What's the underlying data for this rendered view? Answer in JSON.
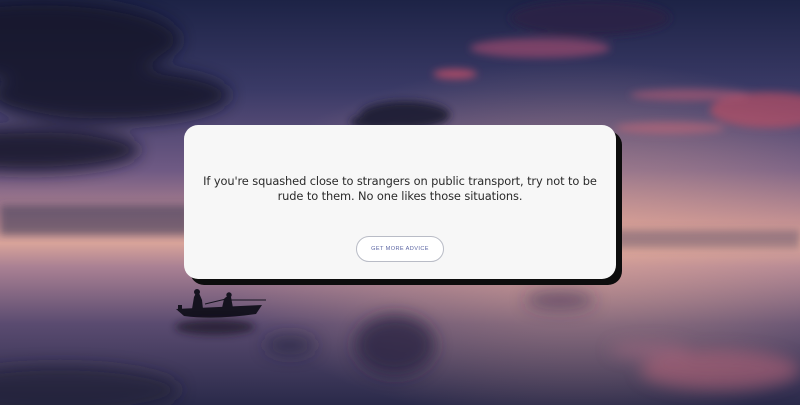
{
  "advice": {
    "text": "If you're squashed close to strangers on public transport, try not to be rude to them. No one likes those situations."
  },
  "button": {
    "label": "GET MORE ADVICE"
  },
  "colors": {
    "card_background": "#f7f7f7",
    "card_shadow": "#0d0d0d",
    "button_text": "#5c66a3",
    "button_border": "#b9bcc6",
    "text": "#2a2a2a"
  },
  "background": {
    "scene": "sunset-lake-with-fishing-boat"
  }
}
